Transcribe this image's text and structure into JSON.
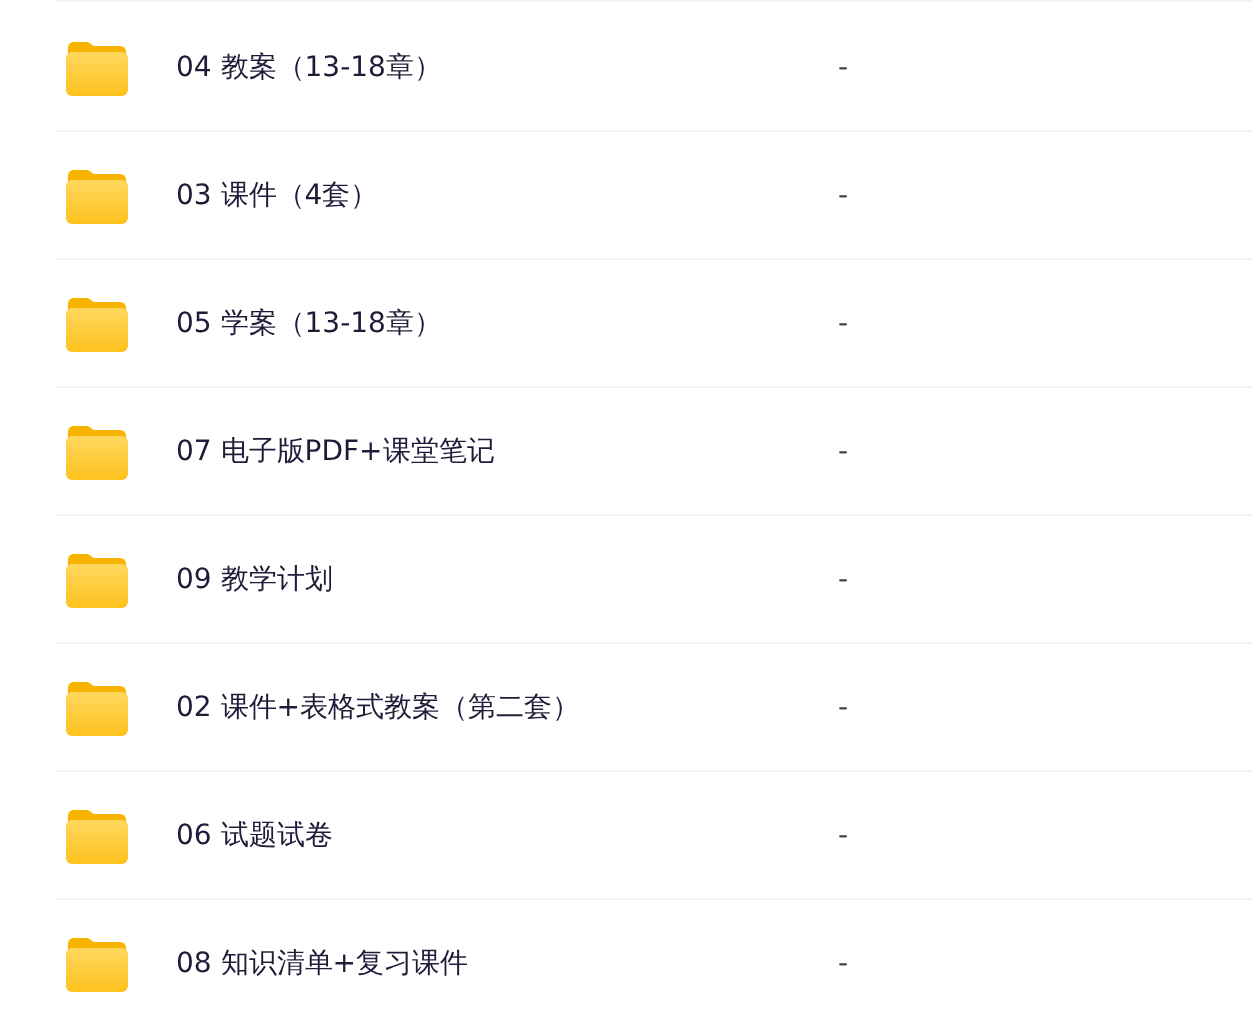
{
  "files": [
    {
      "name": "04 教案（13-18章）",
      "size": "-"
    },
    {
      "name": "03 课件（4套）",
      "size": "-"
    },
    {
      "name": "05 学案（13-18章）",
      "size": "-"
    },
    {
      "name": "07 电子版PDF+课堂笔记",
      "size": "-"
    },
    {
      "name": "09 教学计划",
      "size": "-"
    },
    {
      "name": "02 课件+表格式教案（第二套）",
      "size": "-"
    },
    {
      "name": "06 试题试卷",
      "size": "-"
    },
    {
      "name": "08 知识清单+复习课件",
      "size": "-"
    }
  ]
}
